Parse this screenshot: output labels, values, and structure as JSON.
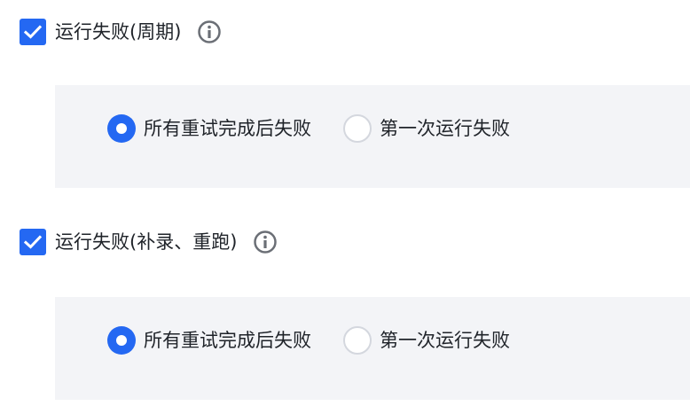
{
  "sections": [
    {
      "checkbox_label": "运行失败(周期)",
      "checked": true,
      "radio_options": [
        {
          "label": "所有重试完成后失败",
          "selected": true
        },
        {
          "label": "第一次运行失败",
          "selected": false
        }
      ]
    },
    {
      "checkbox_label": "运行失败(补录、重跑)",
      "checked": true,
      "radio_options": [
        {
          "label": "所有重试完成后失败",
          "selected": true
        },
        {
          "label": "第一次运行失败",
          "selected": false
        }
      ]
    }
  ],
  "icons": {
    "checkbox": "check-icon",
    "info": "info-icon"
  },
  "colors": {
    "accent": "#2468f2",
    "panel_bg": "#f3f4f7",
    "radio_border": "#d4d7de",
    "info_icon": "#6b6f76"
  }
}
